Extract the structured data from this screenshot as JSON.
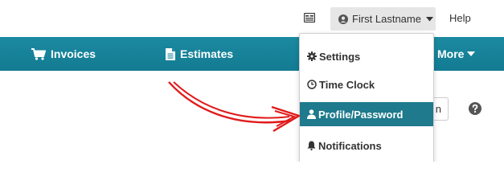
{
  "header": {
    "user_name": "First Lastname",
    "help_label": "Help"
  },
  "nav": {
    "items": [
      {
        "label": "Invoices",
        "icon": "cart-icon"
      },
      {
        "label": "Estimates",
        "icon": "document-icon"
      },
      {
        "label": "More",
        "icon": "caret-down-icon"
      }
    ]
  },
  "dropdown": {
    "items": [
      {
        "label": "Settings",
        "icon": "gear-icon"
      },
      {
        "label": "Time Clock",
        "icon": "clock-icon"
      },
      {
        "label": "Profile/Password",
        "icon": "user-icon",
        "highlighted": true
      },
      {
        "label": "Notifications",
        "icon": "bell-icon"
      }
    ]
  },
  "body": {
    "partial_button_label": "n"
  },
  "colors": {
    "nav_bg": "#1b8aa1",
    "highlight_bg": "#1e7a8c",
    "arrow": "#e11b1b"
  }
}
